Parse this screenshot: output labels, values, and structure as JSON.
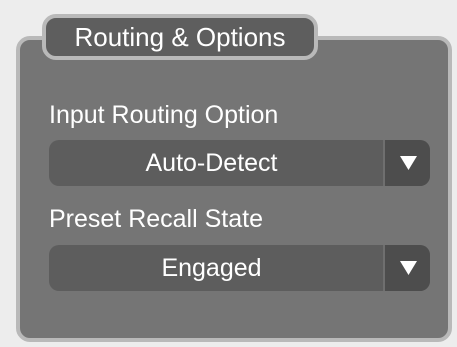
{
  "group": {
    "title": "Routing & Options"
  },
  "fields": [
    {
      "label": "Input Routing Option",
      "value": "Auto-Detect",
      "arrow_icon": "triangle-down-icon"
    },
    {
      "label": "Preset Recall State",
      "value": "Engaged",
      "arrow_icon": "triangle-down-icon"
    }
  ],
  "colors": {
    "panel_background": "#757575",
    "panel_border": "#b9b9b9",
    "control_background": "#5d5d5d",
    "text": "#ffffff"
  }
}
